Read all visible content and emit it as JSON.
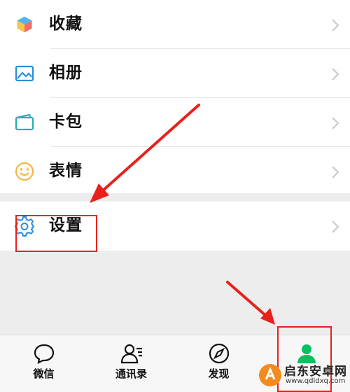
{
  "menu": {
    "items": [
      {
        "label": "收藏",
        "icon": "favorites-cube-icon"
      },
      {
        "label": "相册",
        "icon": "album-picture-icon"
      },
      {
        "label": "卡包",
        "icon": "card-wallet-icon"
      },
      {
        "label": "表情",
        "icon": "emoji-smile-icon"
      }
    ],
    "settings": {
      "label": "设置",
      "icon": "gear-icon"
    }
  },
  "tabbar": {
    "tabs": [
      {
        "label": "微信",
        "icon": "chat-bubble-icon"
      },
      {
        "label": "通讯录",
        "icon": "contacts-icon"
      },
      {
        "label": "发现",
        "icon": "compass-icon"
      },
      {
        "label": "",
        "icon": "person-icon",
        "active": true
      }
    ]
  },
  "watermark": {
    "title": "启东安卓网",
    "url": "www.qdldxq.com"
  },
  "colors": {
    "accent": "#07c160",
    "annotation": "#e8211d",
    "iconBlue": "#2a8fd8"
  }
}
